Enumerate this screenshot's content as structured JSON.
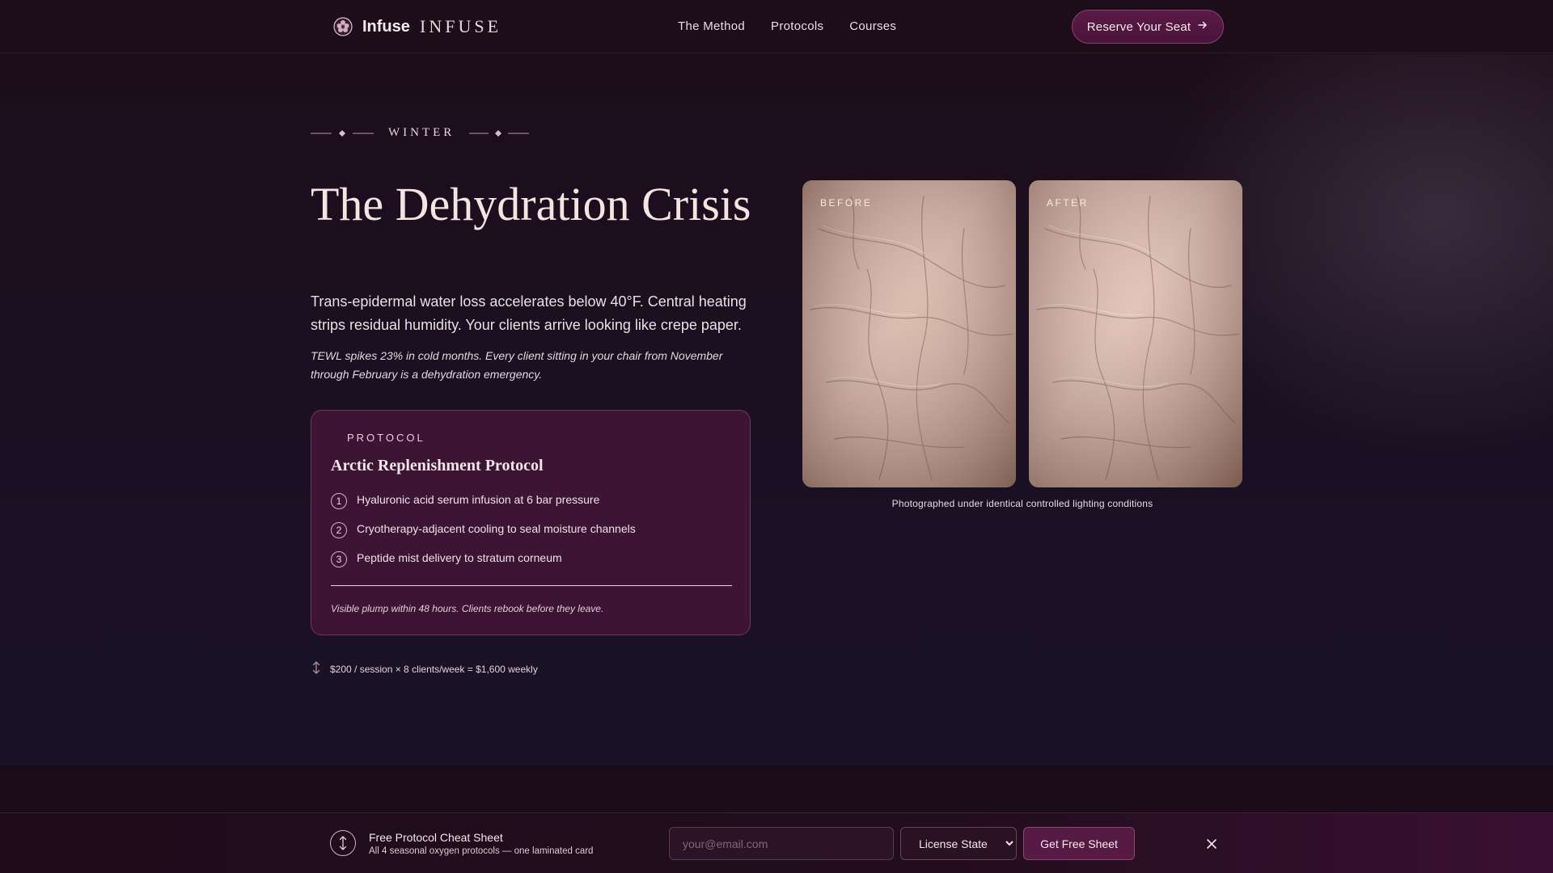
{
  "brand": {
    "name": "Infuse",
    "wordmark": "INFUSE",
    "logo_icon": "floral-seal-icon"
  },
  "nav": {
    "items": [
      {
        "label": "The Method"
      },
      {
        "label": "Protocols"
      },
      {
        "label": "Courses"
      }
    ],
    "cta_label": "Reserve Your Seat",
    "cta_icon": "arrow-right-icon"
  },
  "hero": {
    "season": "WINTER",
    "title": "The Dehydration Crisis",
    "lead": "Trans-epidermal water loss accelerates below 40°F. Central heating strips residual humidity. Your clients arrive looking like crepe paper.",
    "note": "TEWL spikes 23% in cold months. Every client sitting in your chair from November through February is a dehydration emergency."
  },
  "protocol": {
    "kicker": "PROTOCOL",
    "title": "Arctic Replenishment Protocol",
    "steps": [
      {
        "num": "1",
        "text": "Hyaluronic acid serum infusion at 6 bar pressure"
      },
      {
        "num": "2",
        "text": "Cryotherapy-adjacent cooling to seal moisture channels"
      },
      {
        "num": "3",
        "text": "Peptide mist delivery to stratum corneum"
      }
    ],
    "footnote": "Visible plump within 48 hours. Clients rebook before they leave."
  },
  "revenue": {
    "icon": "up-down-arrow-icon",
    "text": "$200 / session × 8 clients/week = $1,600 weekly"
  },
  "comparison": {
    "before_label": "BEFORE",
    "after_label": "AFTER",
    "caption": "Photographed under identical controlled lighting conditions"
  },
  "sticky": {
    "icon": "up-down-arrow-icon",
    "title": "Free Protocol Cheat Sheet",
    "subtitle": "All 4 seasonal oxygen protocols — one laminated card",
    "email_placeholder": "your@email.com",
    "email_value": "",
    "state_selected": "License State",
    "submit_label": "Get Free Sheet",
    "close_icon": "close-icon"
  },
  "colors": {
    "background": "#1b0f1a",
    "accent": "#561a45",
    "card": "#3d1433",
    "text": "#f1e6ea"
  }
}
